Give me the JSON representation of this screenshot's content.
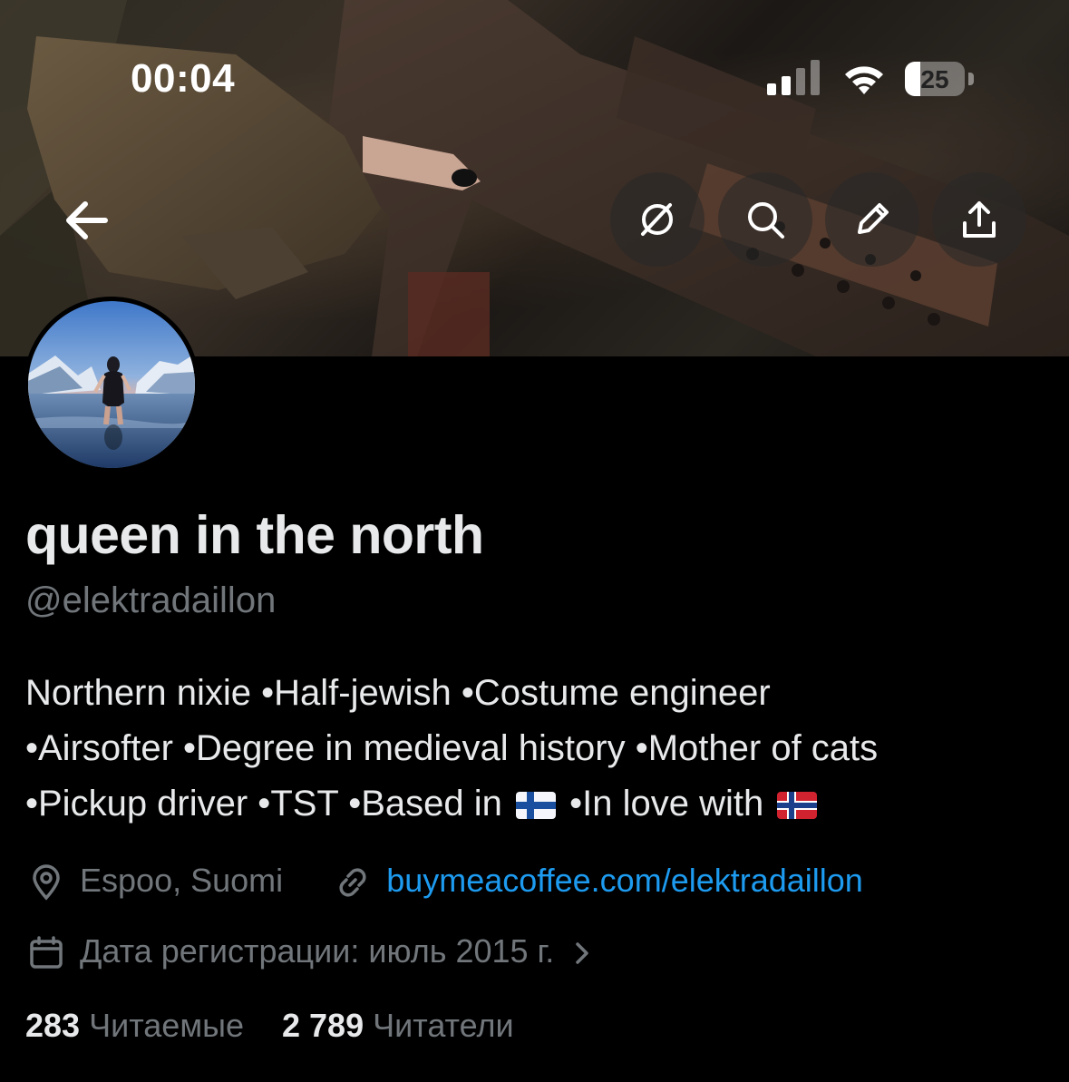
{
  "status_bar": {
    "time": "00:04",
    "battery": "25",
    "battery_level": 0.25
  },
  "header": {
    "back_icon": "arrow-left-icon",
    "grok_icon": "grok-icon",
    "search_icon": "search-icon",
    "edit_icon": "pencil-icon",
    "share_icon": "share-icon"
  },
  "profile": {
    "display_name": "queen in the north",
    "handle": "@elektradaillon",
    "bio": {
      "line1": "Northern nixie •Half-jewish •Costume engineer",
      "line2": "•Airsofter •Degree in medieval history •Mother of cats",
      "line3_a": "•Pickup driver •TST •Based in",
      "line3_b": "•In love with"
    },
    "location": "Espoo, Suomi",
    "website": "buymeacoffee.com/elektradaillon",
    "joined": "Дата регистрации: июль 2015 г.",
    "following_count": "283",
    "following_label": "Читаемые",
    "followers_count": "2 789",
    "followers_label": "Читатели"
  },
  "colors": {
    "background": "#000000",
    "text": "#e7e9ea",
    "muted": "#71767b",
    "link": "#1d9bf0"
  }
}
